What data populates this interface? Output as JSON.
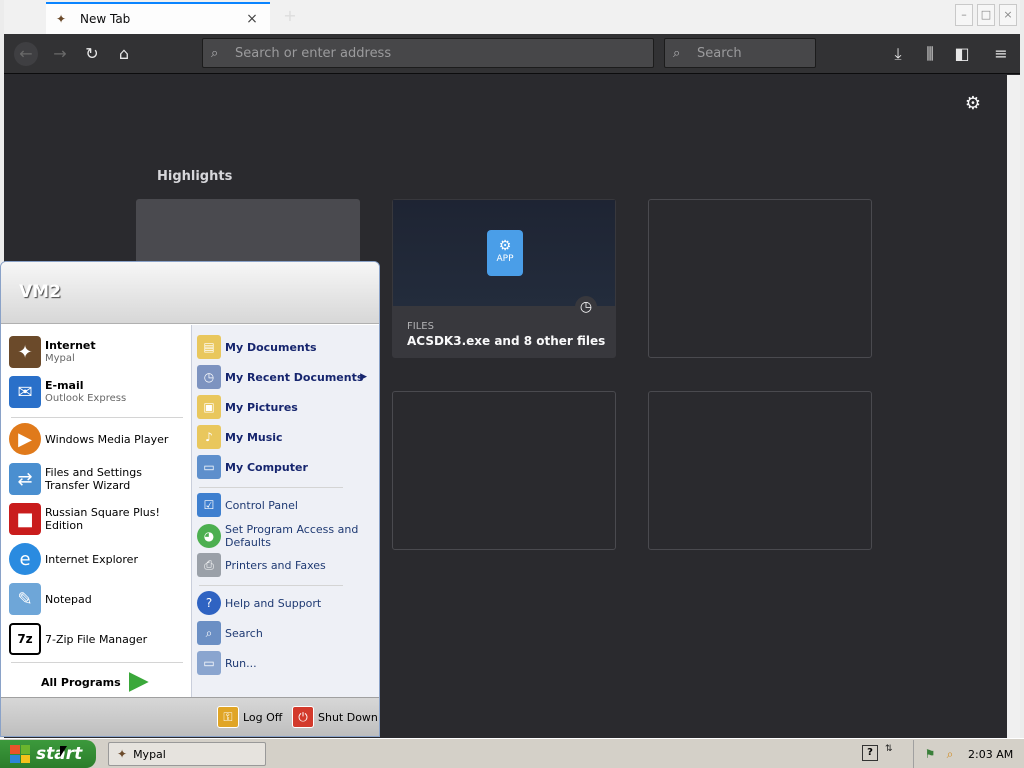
{
  "browser": {
    "tab_title": "New Tab",
    "tab_close": "×",
    "new_tab": "+",
    "window_buttons": {
      "minimize": "–",
      "maximize": "□",
      "close": "×"
    },
    "url_placeholder": "Search or enter address",
    "search_placeholder": "Search"
  },
  "newtab": {
    "highlights_title": "Highlights",
    "card": {
      "icon_label": "APP",
      "context": "FILES",
      "title": "ACSDK3.exe and 8 other files | F..."
    }
  },
  "start_menu": {
    "user": "VM2",
    "pinned": [
      {
        "title": "Internet",
        "subtitle": "Mypal",
        "icon": "mypal-icon"
      },
      {
        "title": "E-mail",
        "subtitle": "Outlook Express",
        "icon": "outlook-icon"
      }
    ],
    "recent": [
      {
        "label": "Windows Media Player",
        "icon": "media-player-icon"
      },
      {
        "label": "Files and Settings Transfer Wizard",
        "icon": "transfer-wizard-icon"
      },
      {
        "label": "Russian Square Plus! Edition",
        "icon": "russian-square-icon"
      },
      {
        "label": "Internet Explorer",
        "icon": "ie-icon"
      },
      {
        "label": "Notepad",
        "icon": "notepad-icon"
      },
      {
        "label": "7-Zip File Manager",
        "icon": "7zip-icon"
      }
    ],
    "sevenzip_glyph": "7z",
    "all_programs": "All Programs",
    "places": [
      {
        "label": "My Documents",
        "icon": "folder-icon"
      },
      {
        "label": "My Recent Documents",
        "icon": "recent-docs-icon"
      },
      {
        "label": "My Pictures",
        "icon": "pictures-icon"
      },
      {
        "label": "My Music",
        "icon": "music-icon"
      },
      {
        "label": "My Computer",
        "icon": "computer-icon"
      }
    ],
    "settings": [
      {
        "label": "Control Panel",
        "icon": "control-panel-icon"
      },
      {
        "label": "Set Program Access and Defaults",
        "icon": "program-access-icon"
      },
      {
        "label": "Printers and Faxes",
        "icon": "printer-icon"
      }
    ],
    "tools": [
      {
        "label": "Help and Support",
        "icon": "help-icon"
      },
      {
        "label": "Search",
        "icon": "search-icon"
      },
      {
        "label": "Run...",
        "icon": "run-icon"
      }
    ],
    "log_off": "Log Off",
    "shut_down": "Shut Down"
  },
  "taskbar": {
    "start_label": "start",
    "task_label": "Mypal",
    "help_glyph": "?",
    "clock": "2:03 AM"
  },
  "colors": {
    "browser_bg": "#2a2a2e",
    "taskbar_bg": "#d4d0c8",
    "start_green": "#3c9a3c",
    "accent_blue": "#0a84ff"
  }
}
